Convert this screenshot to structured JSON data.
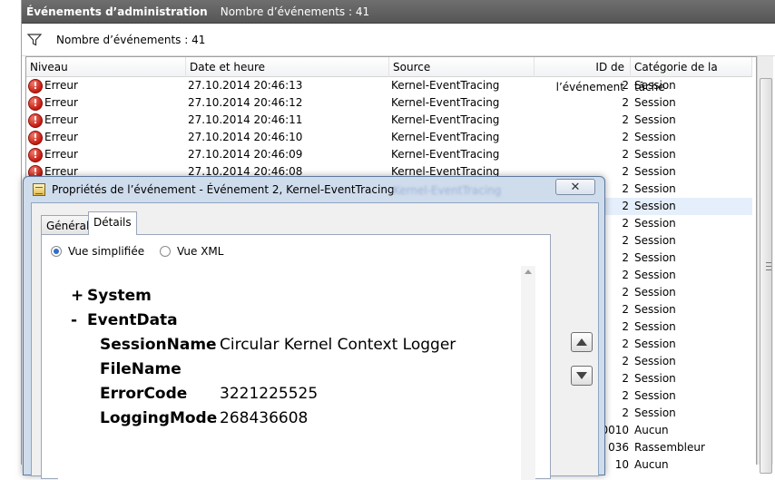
{
  "header": {
    "title": "Événements d’administration",
    "count_label": "Nombre d’événements : 41"
  },
  "filter": {
    "label": "Nombre d’événements : 41"
  },
  "table": {
    "columns": [
      "Niveau",
      "Date et heure",
      "Source",
      "ID de l’événement",
      "Catégorie de la tâche"
    ],
    "rows": [
      {
        "level": "Erreur",
        "date": "27.10.2014 20:46:13",
        "source": "Kernel-EventTracing",
        "id": "2",
        "category": "Session"
      },
      {
        "level": "Erreur",
        "date": "27.10.2014 20:46:12",
        "source": "Kernel-EventTracing",
        "id": "2",
        "category": "Session"
      },
      {
        "level": "Erreur",
        "date": "27.10.2014 20:46:11",
        "source": "Kernel-EventTracing",
        "id": "2",
        "category": "Session"
      },
      {
        "level": "Erreur",
        "date": "27.10.2014 20:46:10",
        "source": "Kernel-EventTracing",
        "id": "2",
        "category": "Session"
      },
      {
        "level": "Erreur",
        "date": "27.10.2014 20:46:09",
        "source": "Kernel-EventTracing",
        "id": "2",
        "category": "Session"
      },
      {
        "level": "Erreur",
        "date": "27.10.2014 20:46:08",
        "source": "Kernel-EventTracing",
        "id": "2",
        "category": "Session"
      },
      {
        "level": "",
        "date": "",
        "source": "",
        "id": "2",
        "category": "Session"
      },
      {
        "level": "",
        "date": "",
        "source": "",
        "id": "2",
        "category": "Session"
      },
      {
        "level": "",
        "date": "",
        "source": "",
        "id": "2",
        "category": "Session"
      },
      {
        "level": "",
        "date": "",
        "source": "",
        "id": "2",
        "category": "Session"
      },
      {
        "level": "",
        "date": "",
        "source": "",
        "id": "2",
        "category": "Session"
      },
      {
        "level": "",
        "date": "",
        "source": "",
        "id": "2",
        "category": "Session"
      },
      {
        "level": "",
        "date": "",
        "source": "",
        "id": "2",
        "category": "Session"
      },
      {
        "level": "",
        "date": "",
        "source": "",
        "id": "2",
        "category": "Session"
      },
      {
        "level": "",
        "date": "",
        "source": "",
        "id": "2",
        "category": "Session"
      },
      {
        "level": "",
        "date": "",
        "source": "",
        "id": "2",
        "category": "Session"
      },
      {
        "level": "",
        "date": "",
        "source": "",
        "id": "2",
        "category": "Session"
      },
      {
        "level": "",
        "date": "",
        "source": "",
        "id": "2",
        "category": "Session"
      },
      {
        "level": "",
        "date": "",
        "source": "",
        "id": "2",
        "category": "Session"
      },
      {
        "level": "",
        "date": "",
        "source": "",
        "id": "2",
        "category": "Session"
      },
      {
        "level": "",
        "date": "",
        "source": "",
        "id": "0010",
        "category": "Aucun"
      },
      {
        "level": "",
        "date": "",
        "source": "",
        "id": "036",
        "category": "Rassembleur"
      },
      {
        "level": "",
        "date": "",
        "source": "",
        "id": "10",
        "category": "Aucun"
      }
    ],
    "selected_row": 7
  },
  "dialog": {
    "title": "Propriétés de l’événement - Événement 2, Kernel-EventTracing",
    "close_symbol": "✕",
    "tabs": [
      "Général",
      "Détails"
    ],
    "active_tab": "Détails",
    "view_options": {
      "simple": "Vue simplifiée",
      "xml": "Vue XML"
    },
    "selected_view": "simple",
    "tree": {
      "system": {
        "symbol": "+",
        "label": "System"
      },
      "eventdata": {
        "symbol": "-",
        "label": "EventData"
      }
    },
    "event_data": [
      {
        "key": "SessionName",
        "value": "Circular Kernel Context Logger"
      },
      {
        "key": "FileName",
        "value": ""
      },
      {
        "key": "ErrorCode",
        "value": "3221225525"
      },
      {
        "key": "LoggingMode",
        "value": "268436608"
      }
    ],
    "blurred_source": "Kernel-EventTracing"
  },
  "icons": {
    "filter": "filter-icon",
    "error": "error-icon",
    "dialog": "event-properties-icon",
    "up": "arrow-up-icon",
    "down": "arrow-down-icon"
  },
  "colors": {
    "titlebar": "#5f5f5f",
    "dialog_frame": "#cfdcec",
    "selected_row": "#e5eefb",
    "error_red": "#c41a10"
  }
}
